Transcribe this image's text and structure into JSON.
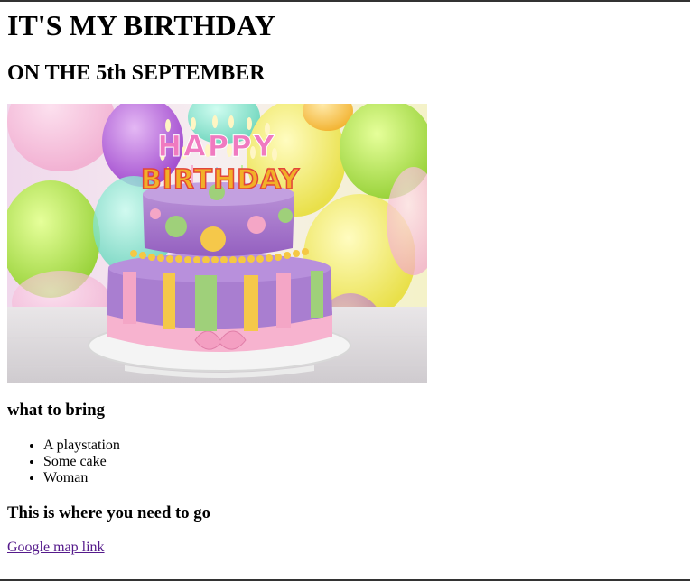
{
  "page": {
    "heading": "IT'S MY BIRTHDAY",
    "subheading": "ON THE 5th SEPTEMBER"
  },
  "hero_image": {
    "cake_text_line1": "HAPPY",
    "cake_text_line2": "BIRTHDAY"
  },
  "bring_section": {
    "heading": "what to bring",
    "items": [
      "A playstation",
      "Some cake",
      "Woman"
    ]
  },
  "location_section": {
    "heading": "This is where you need to go",
    "link_label": "Google map link"
  },
  "colors": {
    "link_visited": "#551a8b",
    "frame": "#333333"
  }
}
